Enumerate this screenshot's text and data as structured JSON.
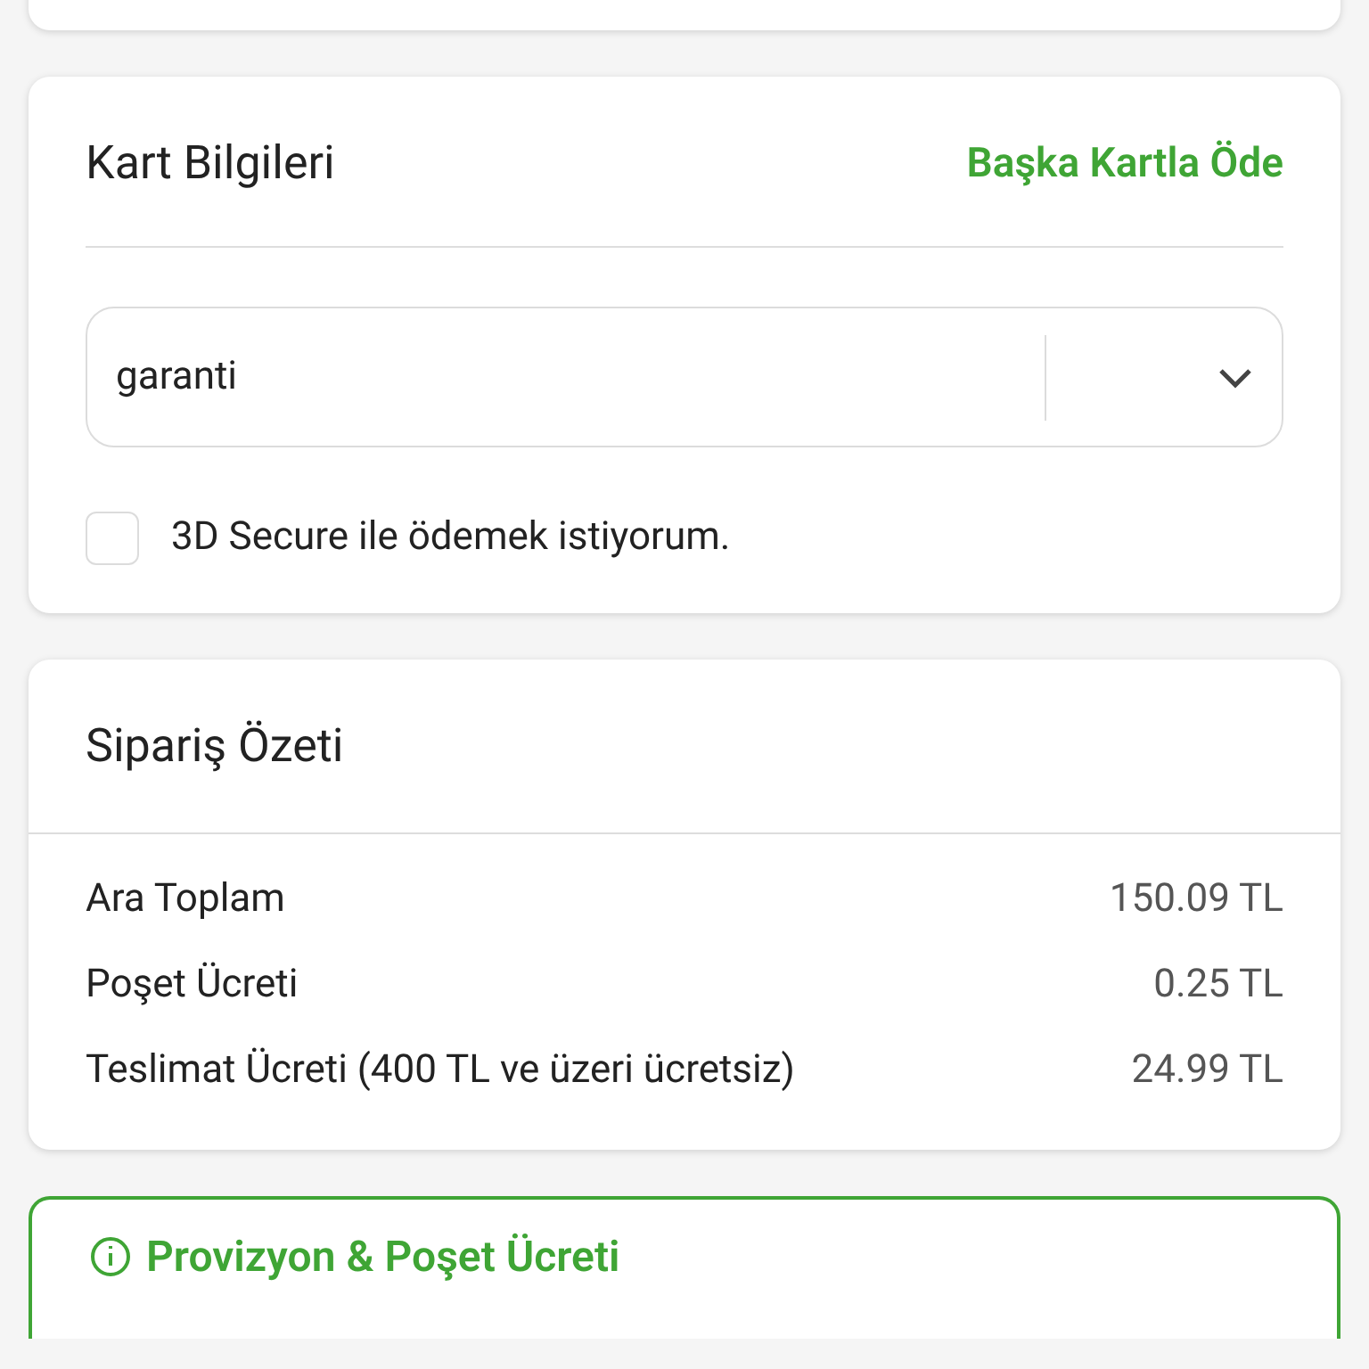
{
  "card_info": {
    "title": "Kart Bilgileri",
    "link": "Başka Kartla Öde",
    "card_select": {
      "value": "garanti"
    },
    "secure_3d": {
      "label": "3D Secure ile ödemek istiyorum.",
      "checked": false
    }
  },
  "order_summary": {
    "title": "Sipariş Özeti",
    "rows": [
      {
        "label": "Ara Toplam",
        "value": "150.09 TL"
      },
      {
        "label": "Poşet Ücreti",
        "value": "0.25 TL"
      },
      {
        "label": "Teslimat Ücreti (400 TL ve üzeri ücretsiz)",
        "value": "24.99 TL"
      }
    ]
  },
  "notice": {
    "title": "Provizyon & Poşet Ücreti"
  }
}
